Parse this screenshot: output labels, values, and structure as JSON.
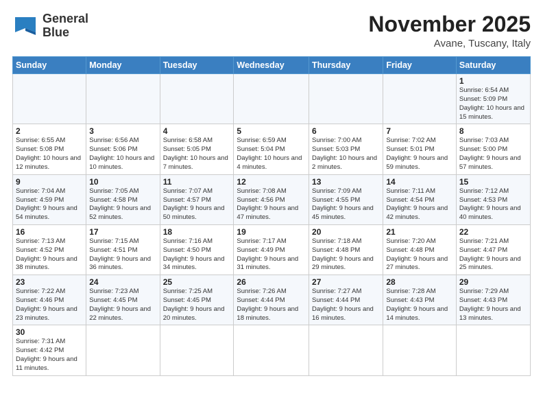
{
  "header": {
    "logo_text_normal": "General",
    "logo_text_bold": "Blue",
    "month_title": "November 2025",
    "location": "Avane, Tuscany, Italy"
  },
  "weekdays": [
    "Sunday",
    "Monday",
    "Tuesday",
    "Wednesday",
    "Thursday",
    "Friday",
    "Saturday"
  ],
  "weeks": [
    [
      {
        "day": "",
        "info": ""
      },
      {
        "day": "",
        "info": ""
      },
      {
        "day": "",
        "info": ""
      },
      {
        "day": "",
        "info": ""
      },
      {
        "day": "",
        "info": ""
      },
      {
        "day": "",
        "info": ""
      },
      {
        "day": "1",
        "info": "Sunrise: 6:54 AM\nSunset: 5:09 PM\nDaylight: 10 hours and 15 minutes."
      }
    ],
    [
      {
        "day": "2",
        "info": "Sunrise: 6:55 AM\nSunset: 5:08 PM\nDaylight: 10 hours and 12 minutes."
      },
      {
        "day": "3",
        "info": "Sunrise: 6:56 AM\nSunset: 5:06 PM\nDaylight: 10 hours and 10 minutes."
      },
      {
        "day": "4",
        "info": "Sunrise: 6:58 AM\nSunset: 5:05 PM\nDaylight: 10 hours and 7 minutes."
      },
      {
        "day": "5",
        "info": "Sunrise: 6:59 AM\nSunset: 5:04 PM\nDaylight: 10 hours and 4 minutes."
      },
      {
        "day": "6",
        "info": "Sunrise: 7:00 AM\nSunset: 5:03 PM\nDaylight: 10 hours and 2 minutes."
      },
      {
        "day": "7",
        "info": "Sunrise: 7:02 AM\nSunset: 5:01 PM\nDaylight: 9 hours and 59 minutes."
      },
      {
        "day": "8",
        "info": "Sunrise: 7:03 AM\nSunset: 5:00 PM\nDaylight: 9 hours and 57 minutes."
      }
    ],
    [
      {
        "day": "9",
        "info": "Sunrise: 7:04 AM\nSunset: 4:59 PM\nDaylight: 9 hours and 54 minutes."
      },
      {
        "day": "10",
        "info": "Sunrise: 7:05 AM\nSunset: 4:58 PM\nDaylight: 9 hours and 52 minutes."
      },
      {
        "day": "11",
        "info": "Sunrise: 7:07 AM\nSunset: 4:57 PM\nDaylight: 9 hours and 50 minutes."
      },
      {
        "day": "12",
        "info": "Sunrise: 7:08 AM\nSunset: 4:56 PM\nDaylight: 9 hours and 47 minutes."
      },
      {
        "day": "13",
        "info": "Sunrise: 7:09 AM\nSunset: 4:55 PM\nDaylight: 9 hours and 45 minutes."
      },
      {
        "day": "14",
        "info": "Sunrise: 7:11 AM\nSunset: 4:54 PM\nDaylight: 9 hours and 42 minutes."
      },
      {
        "day": "15",
        "info": "Sunrise: 7:12 AM\nSunset: 4:53 PM\nDaylight: 9 hours and 40 minutes."
      }
    ],
    [
      {
        "day": "16",
        "info": "Sunrise: 7:13 AM\nSunset: 4:52 PM\nDaylight: 9 hours and 38 minutes."
      },
      {
        "day": "17",
        "info": "Sunrise: 7:15 AM\nSunset: 4:51 PM\nDaylight: 9 hours and 36 minutes."
      },
      {
        "day": "18",
        "info": "Sunrise: 7:16 AM\nSunset: 4:50 PM\nDaylight: 9 hours and 34 minutes."
      },
      {
        "day": "19",
        "info": "Sunrise: 7:17 AM\nSunset: 4:49 PM\nDaylight: 9 hours and 31 minutes."
      },
      {
        "day": "20",
        "info": "Sunrise: 7:18 AM\nSunset: 4:48 PM\nDaylight: 9 hours and 29 minutes."
      },
      {
        "day": "21",
        "info": "Sunrise: 7:20 AM\nSunset: 4:48 PM\nDaylight: 9 hours and 27 minutes."
      },
      {
        "day": "22",
        "info": "Sunrise: 7:21 AM\nSunset: 4:47 PM\nDaylight: 9 hours and 25 minutes."
      }
    ],
    [
      {
        "day": "23",
        "info": "Sunrise: 7:22 AM\nSunset: 4:46 PM\nDaylight: 9 hours and 23 minutes."
      },
      {
        "day": "24",
        "info": "Sunrise: 7:23 AM\nSunset: 4:45 PM\nDaylight: 9 hours and 22 minutes."
      },
      {
        "day": "25",
        "info": "Sunrise: 7:25 AM\nSunset: 4:45 PM\nDaylight: 9 hours and 20 minutes."
      },
      {
        "day": "26",
        "info": "Sunrise: 7:26 AM\nSunset: 4:44 PM\nDaylight: 9 hours and 18 minutes."
      },
      {
        "day": "27",
        "info": "Sunrise: 7:27 AM\nSunset: 4:44 PM\nDaylight: 9 hours and 16 minutes."
      },
      {
        "day": "28",
        "info": "Sunrise: 7:28 AM\nSunset: 4:43 PM\nDaylight: 9 hours and 14 minutes."
      },
      {
        "day": "29",
        "info": "Sunrise: 7:29 AM\nSunset: 4:43 PM\nDaylight: 9 hours and 13 minutes."
      }
    ],
    [
      {
        "day": "30",
        "info": "Sunrise: 7:31 AM\nSunset: 4:42 PM\nDaylight: 9 hours and 11 minutes."
      },
      {
        "day": "",
        "info": ""
      },
      {
        "day": "",
        "info": ""
      },
      {
        "day": "",
        "info": ""
      },
      {
        "day": "",
        "info": ""
      },
      {
        "day": "",
        "info": ""
      },
      {
        "day": "",
        "info": ""
      }
    ]
  ]
}
